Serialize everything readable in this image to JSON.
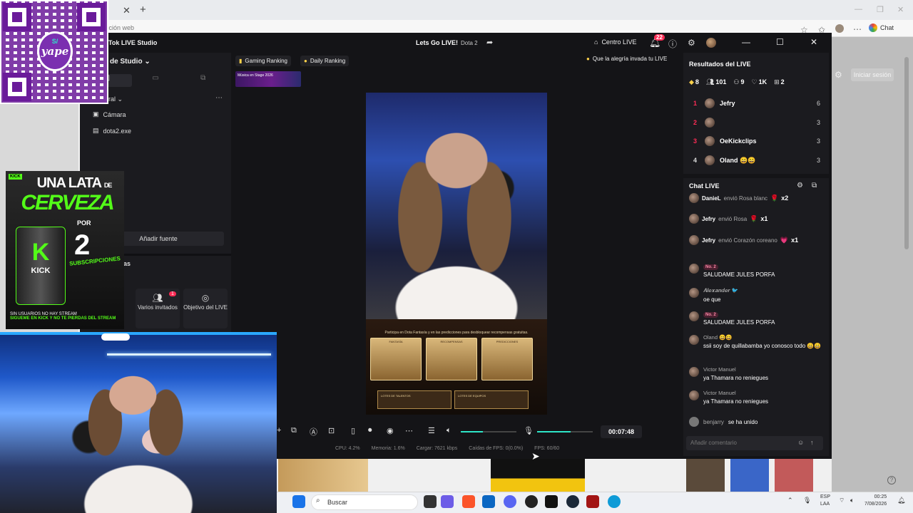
{
  "browser": {
    "address_placeholder": "cción web",
    "chat_label": "Chat",
    "signin_label": "Iniciar sesión"
  },
  "studio": {
    "app_title": "Tok LIVE Studio",
    "live_title": "Lets Go LIVE!",
    "live_game": "Dota 2",
    "centro_label": "Centro LIVE",
    "notif_count": "22",
    "scene_label": "de Studio",
    "general_label": "ral",
    "sources": [
      {
        "icon": "camera-icon",
        "label": "Cámara"
      },
      {
        "icon": "window-capture-icon",
        "label": "dota2.exe"
      }
    ],
    "add_source_label": "Añadir fuente",
    "tools_label": "tas",
    "tools": [
      {
        "label": "Varios invitados",
        "badge": "1"
      },
      {
        "label": "Objetivo del LIVE"
      }
    ],
    "ranking_pills": [
      "Gaming Ranking",
      "Daily Ranking"
    ],
    "quote_pill": "Que la alegría invada tu LIVE",
    "banner_text": "Música en Stage 2026",
    "timer": "00:07:48",
    "volume_level": 0.4,
    "mic_level": 0.6,
    "status": {
      "cpu": "CPU:  4.2%",
      "memory": "Memoria:  1.6%",
      "upload": "Cargar:  7621 kbps",
      "fps_drops": "Caídas de FPS:  0(0.0%)",
      "fps": "FPS:  60/60"
    }
  },
  "game_overlay": {
    "intro": "Participa en Dota Fantasía y en las predicciones para desbloquear recompensas gratuitas.",
    "cards": [
      "FANTASÍA",
      "RECOMPENSAS",
      "PREDICCIONES"
    ],
    "buttons": [
      "LOTES DE TALENTOS",
      "LOTES DE EQUIPOS"
    ]
  },
  "results": {
    "title": "Resultados del LIVE",
    "stats": {
      "diamonds": "8",
      "viewers": "101",
      "new_followers": "9",
      "likes": "1K",
      "gifts": "2"
    },
    "ranking": [
      {
        "rank": "1",
        "name": "Jefry",
        "score": "6"
      },
      {
        "rank": "2",
        "name": "",
        "score": "3"
      },
      {
        "rank": "3",
        "name": "OeKickclips",
        "score": "3"
      },
      {
        "rank": "4",
        "name": "Oland 😄😄",
        "score": "3"
      }
    ]
  },
  "chat": {
    "title": "Chat LIVE",
    "gifts": [
      {
        "user": "DanieL",
        "action": "envió Rosa blanc",
        "mult": "x2"
      },
      {
        "user": "Jefry",
        "action": "envió Rosa",
        "mult": "x1"
      },
      {
        "user": "Jefry",
        "action": "envió Corazón coreano",
        "mult": "x1"
      }
    ],
    "messages": [
      {
        "user": "No. 2",
        "is_badge": true,
        "text": "SALUDAME JULES PORFA"
      },
      {
        "user": "𝑨𝒍𝒆𝒙𝒂𝒏𝒅𝒆𝒓 🐦",
        "is_badge": false,
        "text": "oe que"
      },
      {
        "user": "No. 2",
        "is_badge": true,
        "text": "SALUDAME JULES PORFA"
      },
      {
        "user": "Oland 😄😄",
        "is_badge": false,
        "text": "ssii soy de quillabamba yo conosco todo 😄😄"
      },
      {
        "user": "Victor Manuel",
        "is_badge": false,
        "text": "ya Thamara no reniegues"
      },
      {
        "user": "Victor Manuel",
        "is_badge": false,
        "text": "ya Thamara no reniegues"
      }
    ],
    "joined": {
      "user": "benjarry",
      "text": "se ha unido"
    },
    "comment_placeholder": "Añadir comentario"
  },
  "overlays": {
    "yape_symbol": "S/",
    "yape_word": "yape",
    "beer_line1": "UNA LATA",
    "beer_line1b": "DE",
    "beer_line2": "CERVEZA",
    "beer_por": "POR",
    "beer_number": "2",
    "beer_subs": "SUBSCRIPCIONES",
    "beer_brand": "KICK",
    "beer_footer": "SIGUEME EN KICK Y NO TE PIERDAS DEL STREAM",
    "beer_footer2": "SIN USUARIOS NO HAY STREAM"
  },
  "taskbar": {
    "search": "Buscar",
    "lang1": "ESP",
    "lang2": "LAA",
    "time": "00:25",
    "date": "7/08/2026"
  }
}
